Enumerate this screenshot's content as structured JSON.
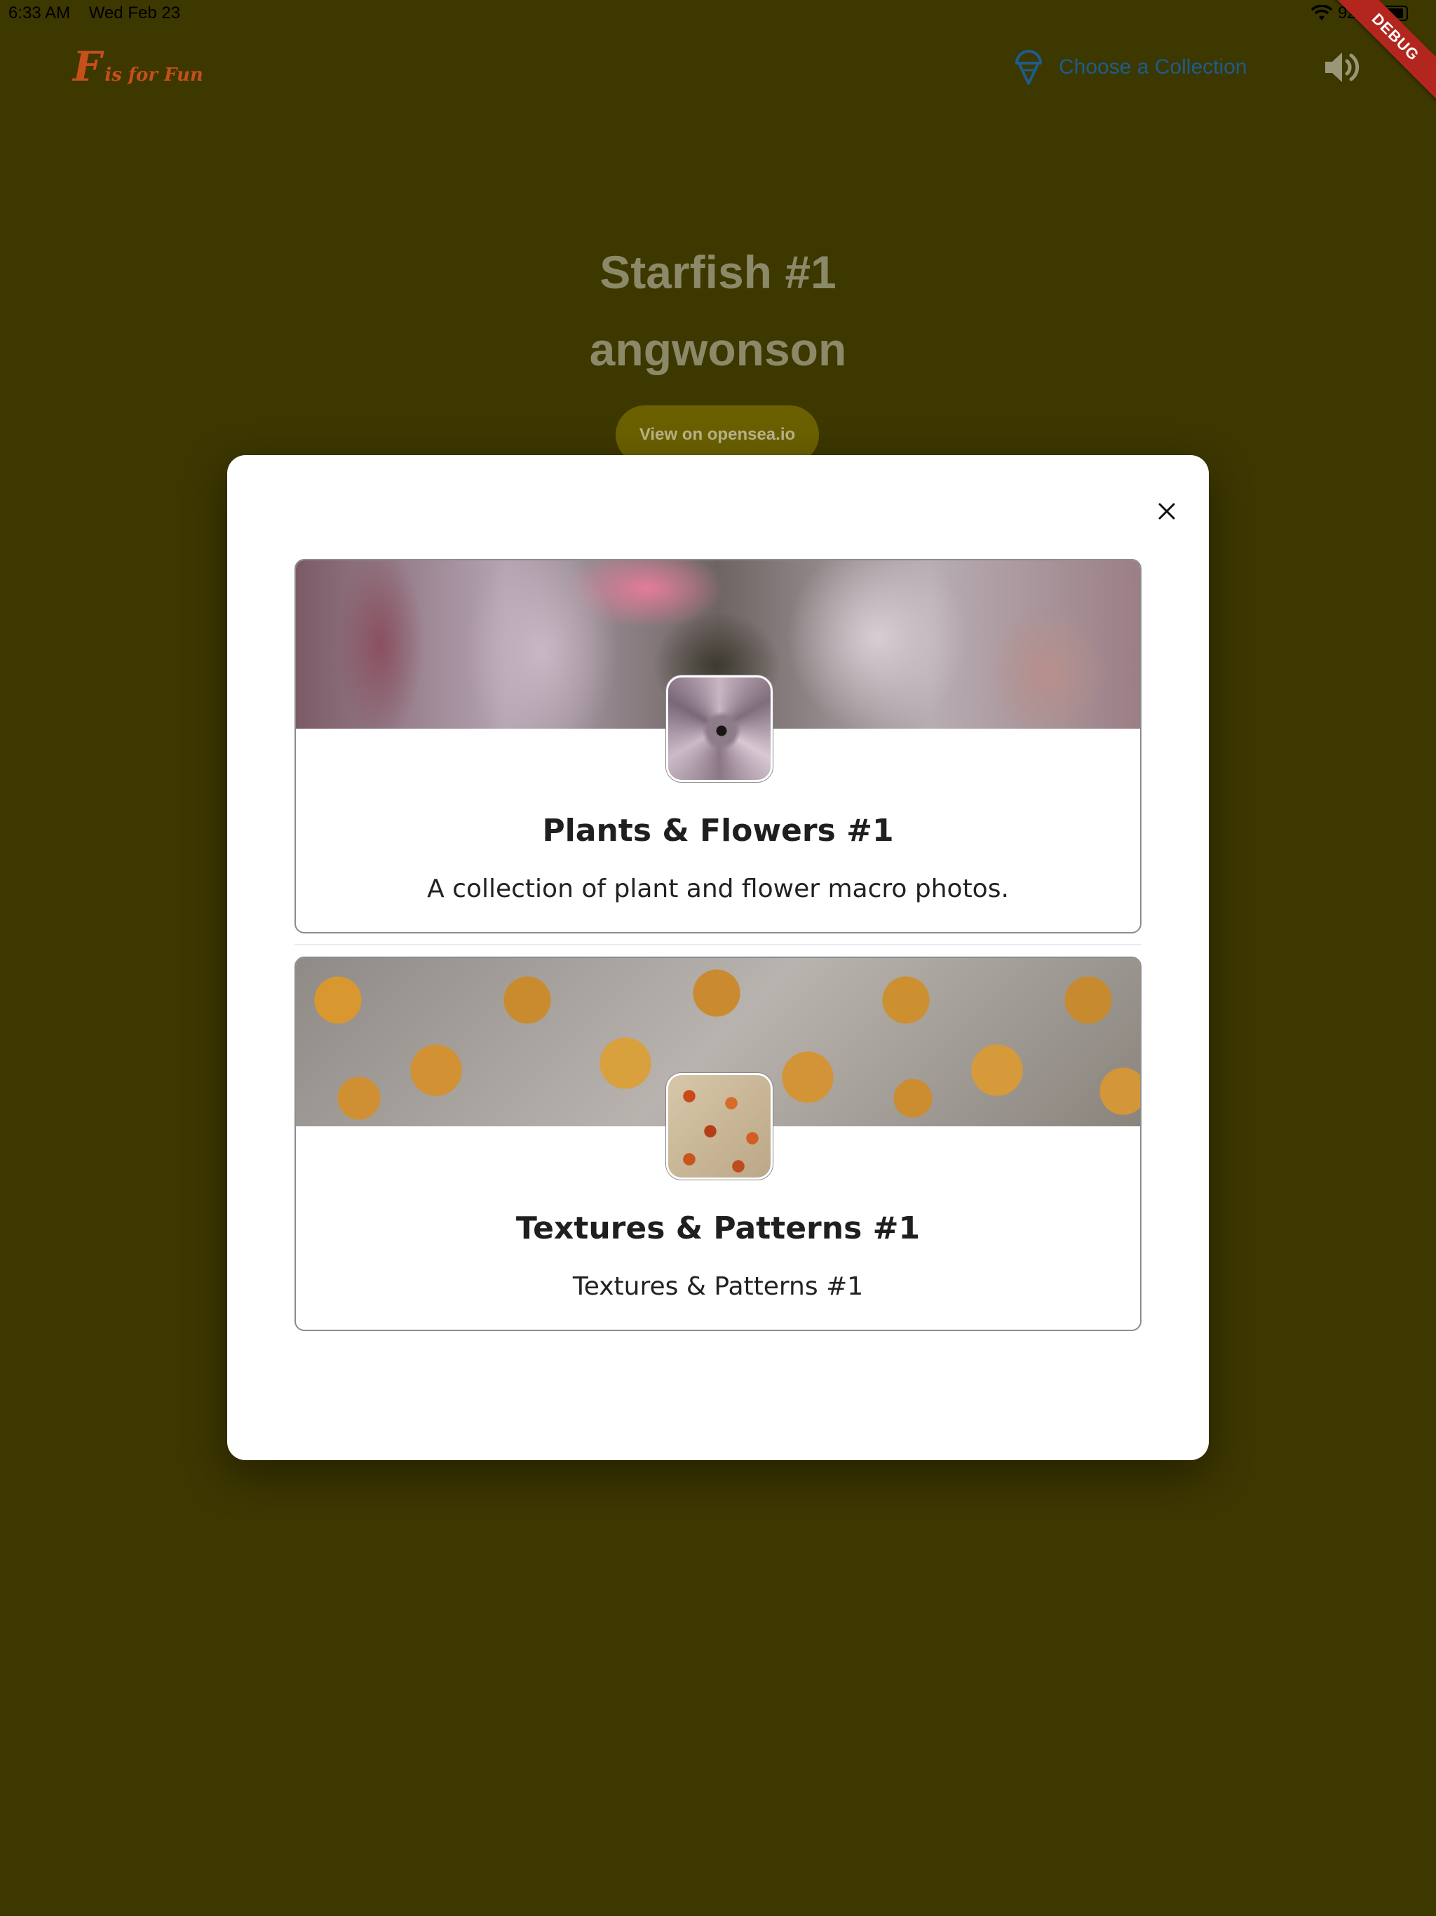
{
  "status_bar": {
    "time": "6:33 AM",
    "date": "Wed Feb 23",
    "battery": "92%",
    "battery_level": 0.92
  },
  "debug_ribbon": "DEBUG",
  "header": {
    "logo_mark": "F",
    "logo_text": "is for Fun",
    "choose_collection_label": "Choose a Collection",
    "choose_collection_icon": "ice-cream-icon",
    "speaker_icon": "volume-icon"
  },
  "background": {
    "title": "Starfish #1",
    "artist": "angwonson",
    "view_button_label": "View on opensea.io"
  },
  "modal": {
    "close_icon": "close-icon",
    "collections": [
      {
        "title": "Plants & Flowers #1",
        "description": "A collection of plant and flower macro photos."
      },
      {
        "title": "Textures & Patterns #1",
        "description": "Textures & Patterns #1"
      }
    ]
  },
  "colors": {
    "background": "#3d3700",
    "accent_link": "#1d5d8c",
    "logo": "#c4501a",
    "debug": "#b3261e"
  }
}
